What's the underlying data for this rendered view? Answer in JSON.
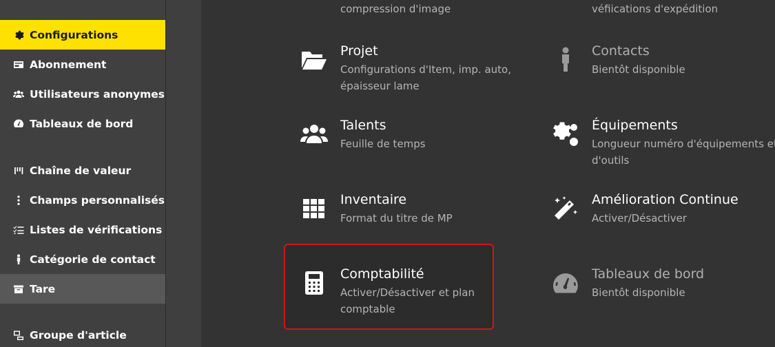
{
  "sidebar": {
    "items": [
      {
        "label": "Configurations",
        "icon": "gear-icon"
      },
      {
        "label": "Abonnement",
        "icon": "card-icon"
      },
      {
        "label": "Utilisateurs anonymes",
        "icon": "users-icon"
      },
      {
        "label": "Tableaux de bord",
        "icon": "gauge-icon"
      },
      {
        "label": "Chaîne de valeur",
        "icon": "bars-icon"
      },
      {
        "label": "Champs personnalisés",
        "icon": "vertical-dots-icon"
      },
      {
        "label": "Listes de vérifications",
        "icon": "checklist-icon"
      },
      {
        "label": "Catégorie de contact",
        "icon": "person-icon"
      },
      {
        "label": "Tare",
        "icon": "box-icon"
      },
      {
        "label": "Groupe d'article",
        "icon": "group-icon"
      }
    ]
  },
  "main": {
    "top_left_desc": "compression d'image",
    "top_right_desc": "véfiications d'expédition",
    "cards": [
      {
        "title": "Projet",
        "desc": "Configurations d'Item, imp. auto, épaisseur lame",
        "icon": "folder-open-icon"
      },
      {
        "title": "Contacts",
        "desc": "Bientôt disponible",
        "icon": "person-icon"
      },
      {
        "title": "Talents",
        "desc": "Feuille de temps",
        "icon": "users-icon"
      },
      {
        "title": "Équipements",
        "desc": "Longueur numéro d'équipements et d'outils",
        "icon": "gears-icon"
      },
      {
        "title": "Inventaire",
        "desc": "Format du titre de MP",
        "icon": "grid-icon"
      },
      {
        "title": "Amélioration Continue",
        "desc": "Activer/Désactiver",
        "icon": "magic-wand-icon"
      },
      {
        "title": "Comptabilité",
        "desc": "Activer/Désactiver et plan comptable",
        "icon": "calculator-icon"
      },
      {
        "title": "Tableaux de bord",
        "desc": "Bientôt disponible",
        "icon": "gauge-icon"
      }
    ]
  },
  "colors": {
    "accent": "#FFE100",
    "highlight_border": "#d0151b",
    "background": "#333333",
    "sidebar": "#404040"
  }
}
